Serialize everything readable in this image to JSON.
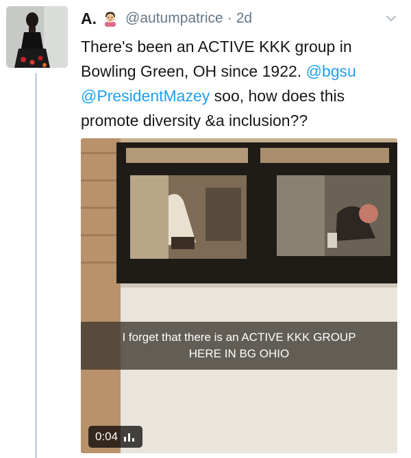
{
  "tweet": {
    "display_name": "A.",
    "emoji_icon": "person-emoji-icon",
    "handle": "@autumpatrice",
    "separator": "·",
    "time": "2d",
    "menu_icon": "chevron-down-icon",
    "text": {
      "line1": "There's been an ACTIVE KKK group in",
      "line2_a": "Bowling Green, OH since 1922.",
      "line2_mention": "@bgsu",
      "line3_mention": "@PresidentMazey",
      "line3_b": "soo, how does this",
      "line4": "promote diversity &a inclusion??"
    },
    "media": {
      "caption_line1": "I forget that there is an ACTIVE KKK GROUP",
      "caption_line2": "HERE IN BG OHIO",
      "duration": "0:04",
      "volume_icon": "audio-bars-icon"
    }
  }
}
